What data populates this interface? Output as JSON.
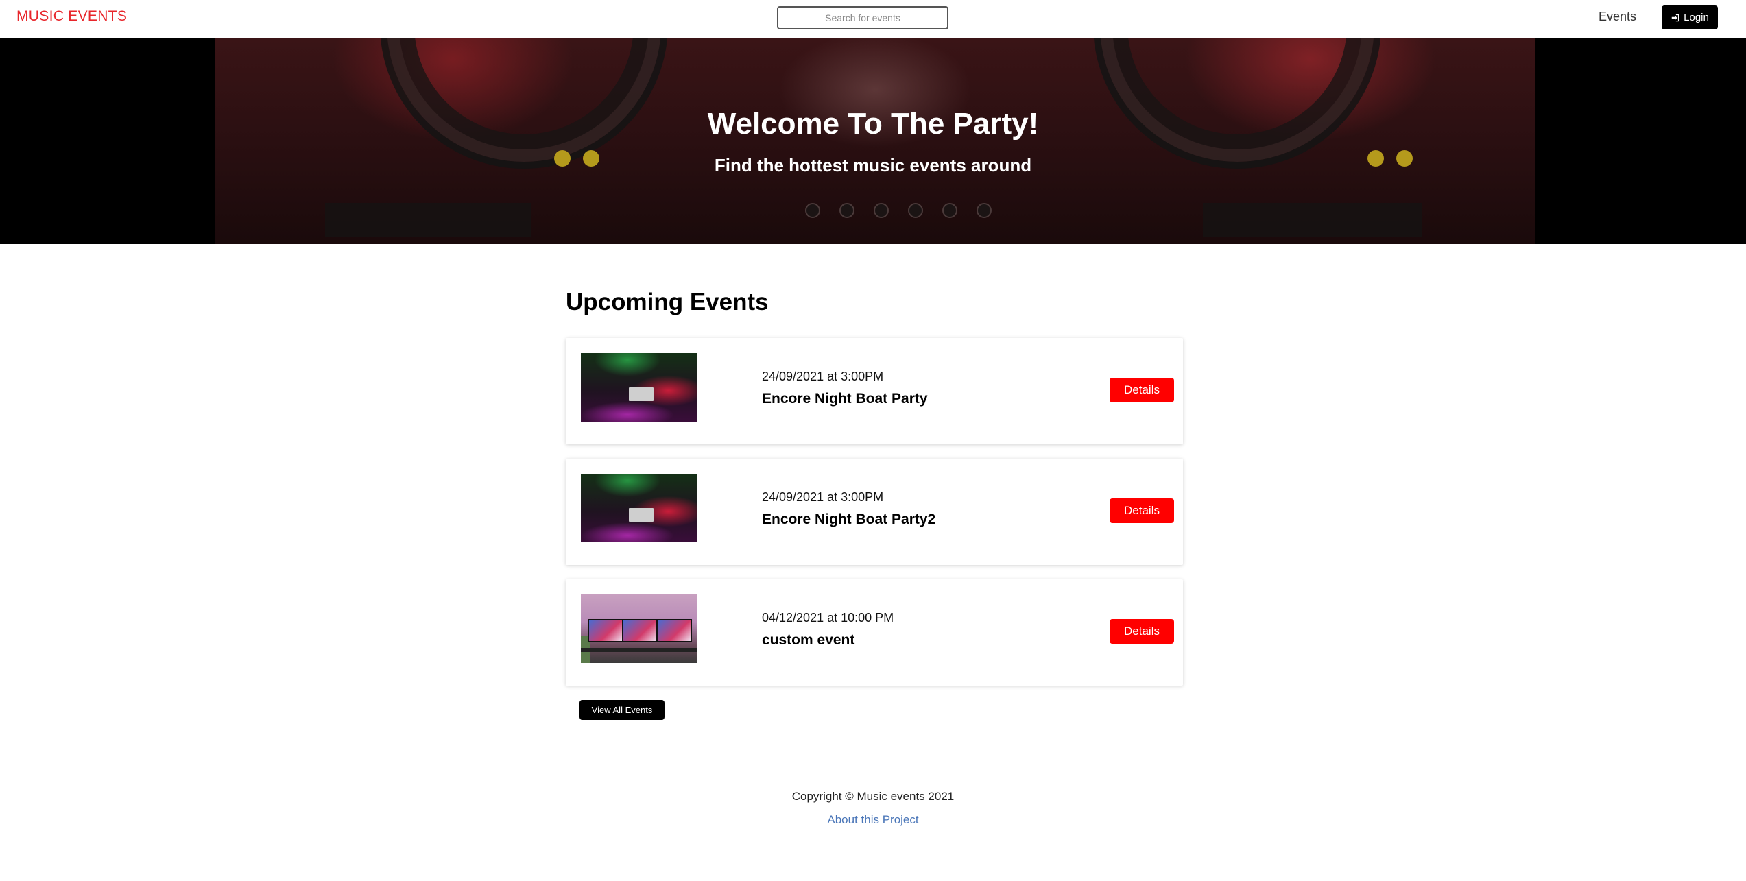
{
  "navbar": {
    "brand": "MUSIC EVENTS",
    "search_placeholder": "Search for events",
    "events_link": "Events",
    "login_label": "Login"
  },
  "hero": {
    "title": "Welcome To The Party!",
    "subtitle": "Find the hottest music events around"
  },
  "main": {
    "section_title": "Upcoming Events",
    "events": [
      {
        "date": "24/09/2021 at 3:00PM",
        "name": "Encore Night Boat Party",
        "details_label": "Details"
      },
      {
        "date": "24/09/2021 at 3:00PM",
        "name": "Encore Night Boat Party2",
        "details_label": "Details"
      },
      {
        "date": "04/12/2021 at 10:00 PM",
        "name": "custom event",
        "details_label": "Details"
      }
    ],
    "view_all_label": "View All Events"
  },
  "footer": {
    "copyright": "Copyright © Music events 2021",
    "about_link": "About this Project"
  },
  "colors": {
    "brand": "#e8262b",
    "details_button": "#ff0000",
    "dark_button": "#000000",
    "link": "#4a76b8"
  }
}
